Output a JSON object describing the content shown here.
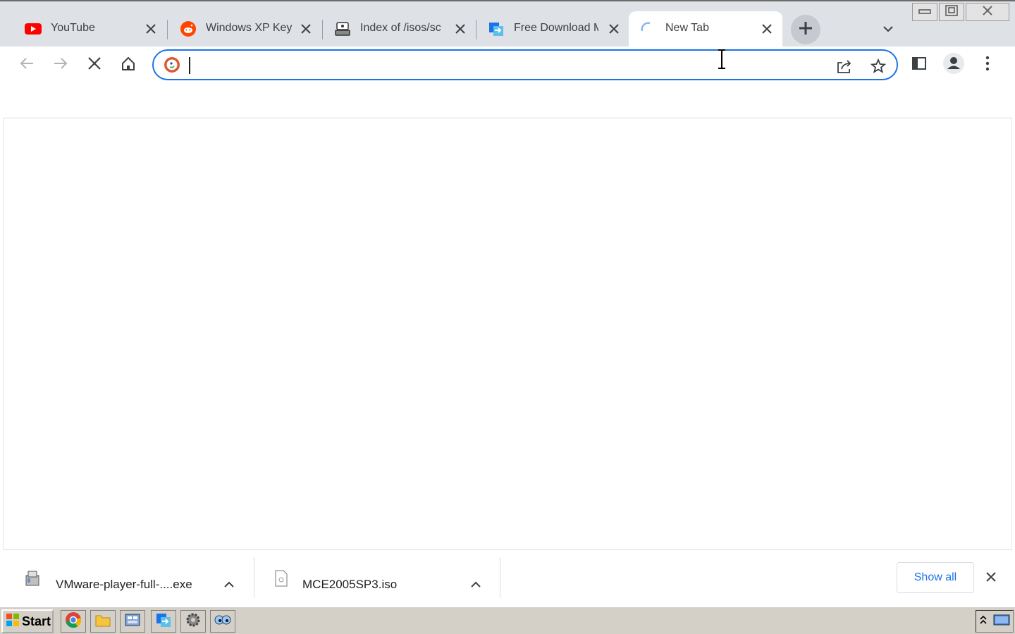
{
  "window": {
    "controls": {
      "minimize_icon": "minimize-icon",
      "restore_icon": "restore-icon",
      "close_icon": "close-icon"
    }
  },
  "tabs": [
    {
      "label": "YouTube",
      "icon": "youtube-icon",
      "active": false
    },
    {
      "label": "Windows XP Key",
      "icon": "reddit-icon",
      "active": false
    },
    {
      "label": "Index of /isos/sc",
      "icon": "server-icon",
      "active": false
    },
    {
      "label": "Free Download M",
      "icon": "download-manager-icon",
      "active": false
    },
    {
      "label": "New Tab",
      "icon": "loading-spinner-icon",
      "active": true
    }
  ],
  "toolbar": {
    "back_icon": "back-arrow-icon",
    "forward_icon": "forward-arrow-icon",
    "stop_icon": "stop-icon",
    "home_icon": "home-icon"
  },
  "omnibox": {
    "value": "",
    "placeholder": "",
    "search_engine_icon": "duckduckgo-icon"
  },
  "downloads": [
    {
      "filename": "VMware-player-full-....exe",
      "icon": "installer-icon"
    },
    {
      "filename": "MCE2005SP3.iso",
      "icon": "file-icon"
    }
  ],
  "shelf": {
    "show_all_label": "Show all"
  },
  "taskbar": {
    "start_label": "Start"
  },
  "colors": {
    "accent": "#1a73e8",
    "tabstrip": "#dee1e6",
    "taskbar": "#d4d0c8"
  }
}
